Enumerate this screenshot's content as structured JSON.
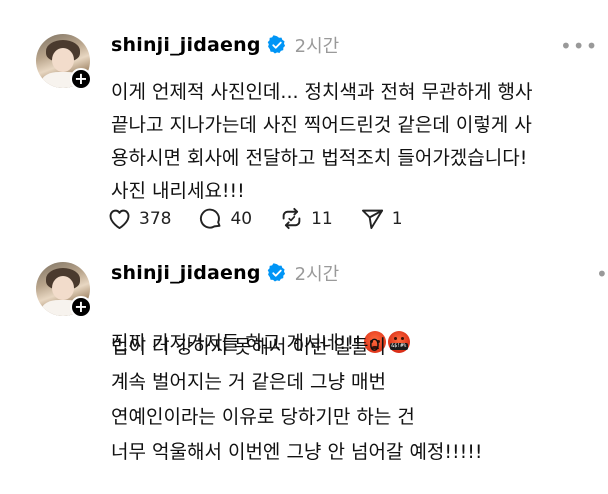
{
  "posts": [
    {
      "username": "shinji_jidaeng",
      "timestamp": "2시간",
      "more_label": "•••",
      "follow_badge": "+",
      "text": "이게 언제적 사진인데... 정치색과 전혀 무관하게 행사\n끝나고 지나가는데 사진 찍어드린것 같은데 이렇게 사\n용하시면 회사에 전달하고 법적조치 들어가겠습니다!\n사진 내리세요!!!",
      "actions": {
        "likes": "378",
        "replies": "40",
        "reposts": "11",
        "shares": "1"
      }
    },
    {
      "username": "shinji_jidaeng",
      "timestamp": "2시간",
      "more_label": "•",
      "follow_badge": "+",
      "text_line1": "진짜 가지가지들 하고 계시네!!!",
      "emojis": [
        "angry-face-emoji",
        "cursing-face-emoji"
      ],
      "cursing_symbols": "&$!#%",
      "text_rest": "법이 더 강하지 못해서 이런 일들이\n계속 벌어지는 거 같은데 그냥 매번\n연예인이라는 이유로 당하기만 하는 건\n너무 억울해서 이번엔 그냥 안 넘어갈 예정!!!!!"
    }
  ],
  "icons": {
    "like": "heart-icon",
    "reply": "comment-icon",
    "repost": "repost-icon",
    "share": "send-icon",
    "verified": "verified-badge-icon"
  },
  "colors": {
    "verified": "#0095f6",
    "muted": "#9a9a9a",
    "text": "#111111"
  }
}
